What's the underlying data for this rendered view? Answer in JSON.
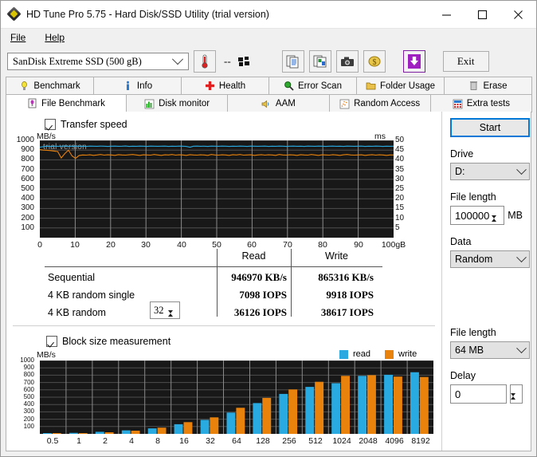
{
  "window": {
    "title": "HD Tune Pro 5.75 - Hard Disk/SSD Utility (trial version)",
    "app_icon": "hd-tune-diamond-icon",
    "minimize": "—",
    "maximize": "□",
    "close": "✕"
  },
  "menu": [
    {
      "label": "File",
      "mnemonic": "F"
    },
    {
      "label": "Help",
      "mnemonic": "H"
    }
  ],
  "toolbar": {
    "drive_selected": "SanDisk Extreme SSD (500 gB)",
    "temperature_icon": "thermometer-icon",
    "temperature_value": "--",
    "disk_icon": "hard-disk-icon",
    "buttons": [
      {
        "name": "copy-icon",
        "glyph": "documents"
      },
      {
        "name": "copy-image-icon",
        "glyph": "image-documents"
      },
      {
        "name": "screenshot-camera-icon",
        "glyph": "camera"
      },
      {
        "name": "money-icon",
        "glyph": "money"
      },
      {
        "name": "download-icon",
        "glyph": "down-arrow"
      }
    ],
    "exit_label": "Exit"
  },
  "tabs_row1": [
    {
      "label": "Benchmark",
      "icon": "lightbulb-icon",
      "active": false
    },
    {
      "label": "Info",
      "icon": "info-icon",
      "active": false
    },
    {
      "label": "Health",
      "icon": "red-cross-icon",
      "active": false
    },
    {
      "label": "Error Scan",
      "icon": "magnifier-icon",
      "active": false
    },
    {
      "label": "Folder Usage",
      "icon": "folder-icon",
      "active": false
    },
    {
      "label": "Erase",
      "icon": "trash-icon",
      "active": false
    }
  ],
  "tabs_row2": [
    {
      "label": "File Benchmark",
      "icon": "file-benchmark-icon",
      "active": true
    },
    {
      "label": "Disk monitor",
      "icon": "bar-chart-icon",
      "active": false
    },
    {
      "label": "AAM",
      "icon": "speaker-icon",
      "active": false
    },
    {
      "label": "Random Access",
      "icon": "scatter-icon",
      "active": false
    },
    {
      "label": "Extra tests",
      "icon": "calculator-icon",
      "active": false
    }
  ],
  "transfer_section": {
    "checkbox_label": "Transfer speed",
    "checked": true,
    "watermark": "trial version"
  },
  "results": {
    "col_headers": [
      "Read",
      "Write"
    ],
    "rows": [
      {
        "label": "Sequential",
        "read": "946970 KB/s",
        "write": "865316 KB/s"
      },
      {
        "label": "4 KB random single",
        "read": "7098 IOPS",
        "write": "9918 IOPS"
      },
      {
        "label": "4 KB random",
        "read": "36126 IOPS",
        "write": "38617 IOPS",
        "queue_depth": "32"
      }
    ]
  },
  "block_section": {
    "checkbox_label": "Block size measurement",
    "checked": true
  },
  "right_panel": {
    "start_label": "Start",
    "drive_label": "Drive",
    "drive_value": "D:",
    "file_length_label": "File length",
    "file_length_value": "100000",
    "file_length_unit": "MB",
    "data_label": "Data",
    "data_value": "Random",
    "block_file_length_label": "File length",
    "block_file_length_value": "64 MB",
    "delay_label": "Delay",
    "delay_value": "0"
  },
  "colors": {
    "read": "#29ABE2",
    "write": "#E8820C",
    "plot_bg": "#1c1c1c",
    "grid": "#8a8a8a",
    "accent": "#0078d7"
  },
  "chart_data": [
    {
      "type": "line",
      "title": "Transfer speed",
      "ylabel": "MB/s",
      "y2label": "ms",
      "xlabel": "100gB",
      "ylim": [
        0,
        1000
      ],
      "yticks": [
        100,
        200,
        300,
        400,
        500,
        600,
        700,
        800,
        900,
        1000
      ],
      "y2lim": [
        0,
        50
      ],
      "y2ticks": [
        5,
        10,
        15,
        20,
        25,
        30,
        35,
        40,
        45,
        50
      ],
      "xlim": [
        0,
        100
      ],
      "xticks": [
        "0",
        "10",
        "20",
        "30",
        "40",
        "50",
        "60",
        "70",
        "80",
        "90",
        "100gB"
      ],
      "grid": true,
      "series": [
        {
          "name": "read",
          "color": "#29ABE2",
          "approx_level": 940,
          "values": [
            930,
            936,
            940,
            938,
            941,
            939,
            940,
            942,
            938,
            940,
            941,
            939,
            940,
            938,
            941,
            940,
            939,
            941,
            940,
            938,
            940,
            941,
            939,
            940,
            942,
            938,
            940,
            939,
            941,
            940,
            938,
            941,
            940,
            939,
            940,
            941,
            938,
            940,
            939,
            941,
            940,
            938,
            930,
            940,
            941,
            939,
            940,
            938,
            941,
            940,
            939,
            941,
            940,
            938,
            940,
            939,
            941,
            940,
            938,
            941,
            940,
            939,
            940,
            941,
            938,
            940,
            939,
            941,
            940,
            938,
            940,
            941,
            939,
            940,
            938,
            941,
            940,
            939,
            941,
            940,
            938,
            940,
            941,
            939,
            940,
            938,
            941,
            940,
            939,
            940,
            941,
            938,
            940,
            939,
            941,
            940,
            938,
            940,
            939,
            940
          ]
        },
        {
          "name": "write",
          "color": "#E8820C",
          "approx_level": 865,
          "values": [
            905,
            900,
            898,
            895,
            890,
            885,
            820,
            865,
            900,
            840,
            815,
            845,
            850,
            848,
            852,
            846,
            850,
            855,
            848,
            852,
            850,
            846,
            853,
            850,
            848,
            852,
            855,
            850,
            846,
            852,
            850,
            848,
            855,
            850,
            846,
            852,
            850,
            855,
            848,
            852,
            850,
            846,
            853,
            850,
            848,
            852,
            850,
            846,
            855,
            850,
            848,
            852,
            850,
            846,
            853,
            850,
            855,
            848,
            850,
            852,
            846,
            850,
            853,
            848,
            852,
            850,
            846,
            855,
            850,
            848,
            852,
            850,
            846,
            853,
            850,
            848,
            855,
            850,
            846,
            852,
            850,
            848,
            853,
            850,
            846,
            852,
            855,
            850,
            848,
            850,
            852,
            846,
            850,
            853,
            848,
            852,
            850,
            846,
            850,
            850
          ]
        }
      ]
    },
    {
      "type": "bar",
      "title": "Block size measurement",
      "ylabel": "MB/s",
      "ylim": [
        0,
        1000
      ],
      "yticks": [
        100,
        200,
        300,
        400,
        500,
        600,
        700,
        800,
        900,
        1000
      ],
      "grid": true,
      "legend": [
        "read",
        "write"
      ],
      "legend_position": "top-right",
      "categories": [
        "0.5",
        "1",
        "2",
        "4",
        "8",
        "16",
        "32",
        "64",
        "128",
        "256",
        "512",
        "1024",
        "2048",
        "4096",
        "8192"
      ],
      "series": [
        {
          "name": "read",
          "color": "#29ABE2",
          "values": [
            8,
            14,
            28,
            48,
            75,
            132,
            190,
            290,
            420,
            545,
            640,
            690,
            790,
            805,
            840
          ]
        },
        {
          "name": "write",
          "color": "#E8820C",
          "values": [
            5,
            10,
            22,
            44,
            85,
            160,
            225,
            355,
            490,
            605,
            710,
            790,
            800,
            780,
            775
          ]
        }
      ]
    }
  ]
}
